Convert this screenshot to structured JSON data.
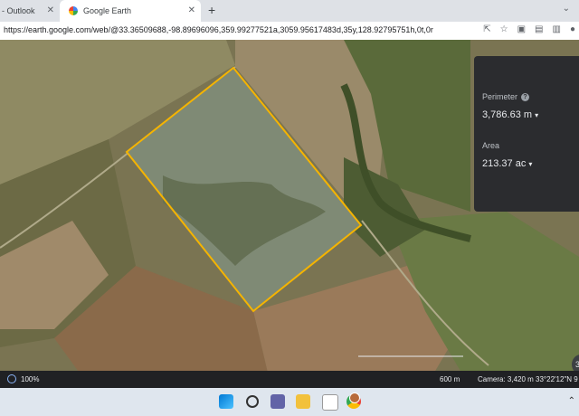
{
  "browser": {
    "tabs": [
      {
        "label": "- Outlook",
        "close": "✕"
      },
      {
        "label": "Google Earth",
        "close": "✕"
      }
    ],
    "new_tab": "+",
    "tab_list": "⌄",
    "url": "https://earth.google.com/web/@33.36509688,-98.89696096,359.99277521a,3059.95617483d,35y,128.92795751h,0t,0r"
  },
  "measure_panel": {
    "perimeter_label": "Perimeter",
    "perimeter_value": "3,786.63 m",
    "area_label": "Area",
    "area_value": "213.37 ac"
  },
  "map": {
    "zoom_out": "−",
    "zoom_in": "+",
    "ruler": "∿",
    "side_fragment": "3"
  },
  "status": {
    "zoom_percent": "100%",
    "scale": "600 m",
    "camera": "Camera: 3,420 m   33°22'12\"N 9"
  },
  "colors": {
    "polygon": "#f5b400",
    "panel_bg": "#2b2c2f"
  }
}
